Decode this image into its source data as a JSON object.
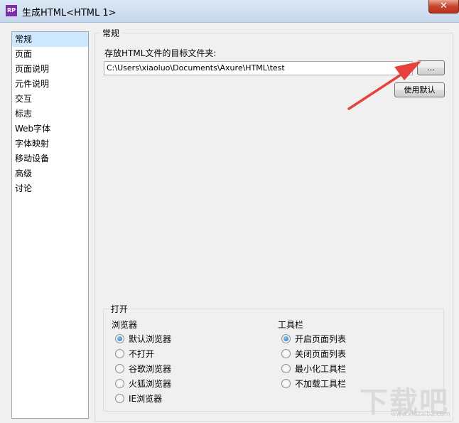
{
  "window": {
    "icon_text": "RP",
    "title": "生成HTML<HTML 1>",
    "close_label": "✕"
  },
  "sidebar": {
    "items": [
      {
        "label": "常规",
        "selected": true
      },
      {
        "label": "页面"
      },
      {
        "label": "页面说明"
      },
      {
        "label": "元件说明"
      },
      {
        "label": "交互"
      },
      {
        "label": "标志"
      },
      {
        "label": "Web字体"
      },
      {
        "label": "字体映射"
      },
      {
        "label": "移动设备"
      },
      {
        "label": "高级"
      },
      {
        "label": "讨论"
      }
    ]
  },
  "general": {
    "legend": "常规",
    "folder_label": "存放HTML文件的目标文件夹:",
    "folder_value": "C:\\Users\\xiaoluo\\Documents\\Axure\\HTML\\test",
    "browse_label": "...",
    "default_label": "使用默认"
  },
  "open": {
    "legend": "打开",
    "browser_heading": "浏览器",
    "browser_options": [
      {
        "label": "默认浏览器",
        "checked": true
      },
      {
        "label": "不打开"
      },
      {
        "label": "谷歌浏览器"
      },
      {
        "label": "火狐浏览器"
      },
      {
        "label": "IE浏览器"
      }
    ],
    "toolbar_heading": "工具栏",
    "toolbar_options": [
      {
        "label": "开启页面列表",
        "checked": true
      },
      {
        "label": "关闭页面列表"
      },
      {
        "label": "最小化工具栏"
      },
      {
        "label": "不加载工具栏"
      }
    ]
  },
  "colors": {
    "selection": "#cde8ff",
    "arrow": "#e8403a",
    "close_button": "#c7442a"
  },
  "watermark": {
    "main": "下载吧",
    "sub": "www.xiazaiba.com"
  }
}
